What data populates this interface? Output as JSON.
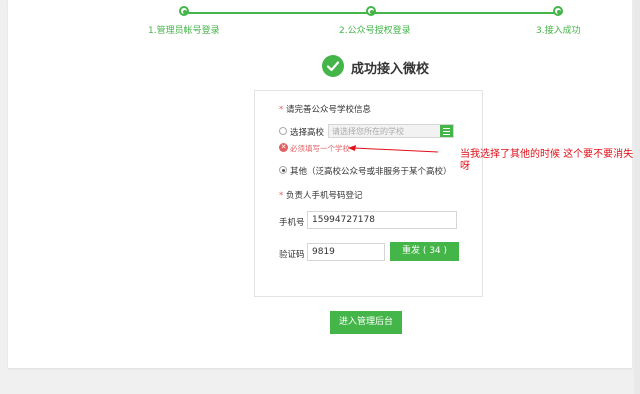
{
  "steps": [
    {
      "label": "1.管理员帐号登录"
    },
    {
      "label": "2.公众号授权登录"
    },
    {
      "label": "3.接入成功"
    }
  ],
  "success": {
    "title": "成功接入微校"
  },
  "form": {
    "school_section_label": "请完善公众号学校信息",
    "required_mark": "*",
    "option_select_school_label": "选择高校",
    "school_select_placeholder": "请选择您所在的学校",
    "error_message": "必须填写一个学校",
    "option_other_label": "其他（泛高校公众号或非服务于某个高校）",
    "phone_section_label": "负责人手机号码登记",
    "phone_label": "手机号",
    "phone_value": "15994727178",
    "code_label": "验证码",
    "code_value": "9819",
    "resend_button": "重发 ( 34 )",
    "submit_button": "进入管理后台"
  },
  "annotation": {
    "text": "当我选择了其他的时候 这个要不要消失呀"
  },
  "colors": {
    "accent": "#44b549",
    "error": "#e15f63",
    "annotation": "#e10f18"
  }
}
